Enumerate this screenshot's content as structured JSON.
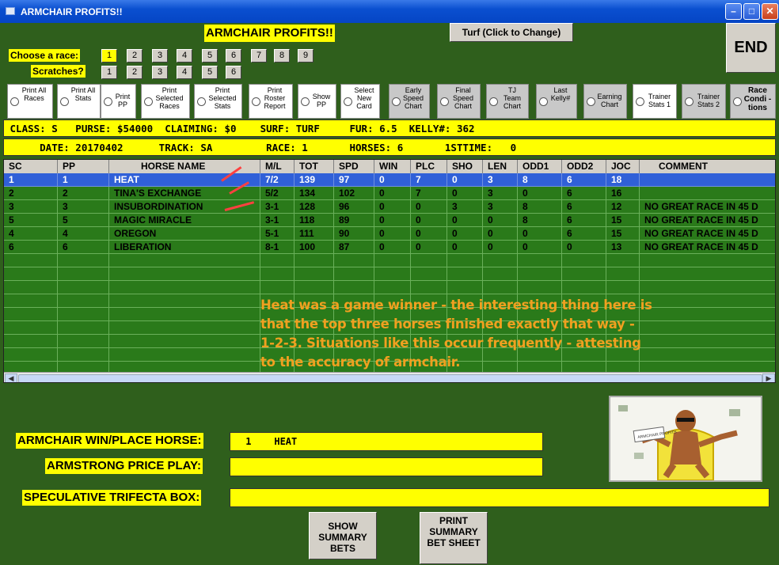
{
  "window": {
    "title": "ARMCHAIR PROFITS!!"
  },
  "header": {
    "app_title": "ARMCHAIR PROFITS!!",
    "turf_button": "Turf (Click to Change)",
    "end_button": "END",
    "choose_race_label": "Choose  a race:",
    "races": [
      "1",
      "2",
      "3",
      "4",
      "5",
      "6",
      "7",
      "8",
      "9"
    ],
    "selected_race": "1",
    "scratches_label": "Scratches?",
    "scratches": [
      "1",
      "2",
      "3",
      "4",
      "5",
      "6"
    ]
  },
  "options": [
    {
      "label": "Print All Races"
    },
    {
      "label": "Print All Stats"
    },
    {
      "label": "Print PP"
    },
    {
      "label": "Print Selected Races"
    },
    {
      "label": "Print Selected Stats"
    },
    {
      "label": "Print Roster Report"
    },
    {
      "label": "Show PP"
    },
    {
      "label": "Select New Card"
    },
    {
      "label": "Early Speed Chart"
    },
    {
      "label": "Final Speed Chart"
    },
    {
      "label": "TJ Team Chart"
    },
    {
      "label": "Last Kelly#"
    },
    {
      "label": "Earning Chart"
    },
    {
      "label": "Trainer Stats 1"
    },
    {
      "label": "Trainer Stats 2"
    },
    {
      "label": "Race Condi -tions"
    }
  ],
  "race_info": {
    "line1": " CLASS: S   PURSE: $54000  CLAIMING: $0    SURF: TURF     FUR: 6.5  KELLY#: 362",
    "line2": "      DATE: 20170402      TRACK: SA         RACE: 1       HORSES: 6       1STTIME:   0"
  },
  "table": {
    "columns": [
      "SC",
      "PP",
      "HORSE NAME",
      "M/L",
      "TOT",
      "SPD",
      "WIN",
      "PLC",
      "SHO",
      "LEN",
      "ODD1",
      "ODD2",
      "JOC",
      "COMMENT"
    ],
    "rows": [
      [
        "1",
        "1",
        "HEAT",
        "7/2",
        "139",
        "97",
        "0",
        "7",
        "0",
        "3",
        "8",
        "6",
        "18",
        ""
      ],
      [
        "2",
        "2",
        "TINA'S EXCHANGE",
        "5/2",
        "134",
        "102",
        "0",
        "7",
        "0",
        "3",
        "0",
        "6",
        "16",
        ""
      ],
      [
        "3",
        "3",
        "INSUBORDINATION",
        "3-1",
        "128",
        "96",
        "0",
        "0",
        "3",
        "3",
        "8",
        "6",
        "12",
        "NO GREAT RACE IN 45 D"
      ],
      [
        "5",
        "5",
        "MAGIC MIRACLE",
        "3-1",
        "118",
        "89",
        "0",
        "0",
        "0",
        "0",
        "8",
        "6",
        "15",
        "NO GREAT RACE IN 45 D"
      ],
      [
        "4",
        "4",
        "OREGON",
        "5-1",
        "111",
        "90",
        "0",
        "0",
        "0",
        "0",
        "0",
        "6",
        "15",
        "NO GREAT RACE IN 45 D"
      ],
      [
        "6",
        "6",
        "LIBERATION",
        "8-1",
        "100",
        "87",
        "0",
        "0",
        "0",
        "0",
        "0",
        "0",
        "13",
        "NO GREAT RACE IN 45 D"
      ]
    ]
  },
  "annotation": {
    "lines": [
      "Heat was a game winner - the interesting thing here is",
      "that the top three horses finished exactly that way -",
      "1-2-3.  Situations like  this occur frequently - attesting",
      "to the accuracy of armchair."
    ]
  },
  "summary": {
    "win_place_label": "ARMCHAIR WIN/PLACE HORSE:",
    "win_place_value": " 1    HEAT",
    "price_play_label": "ARMSTRONG PRICE PLAY:",
    "price_play_value": "",
    "trifecta_label": "SPECULATIVE TRIFECTA BOX:",
    "trifecta_value": "",
    "show_bets_button": "SHOW SUMMARY BETS",
    "print_sheet_button": "PRINT SUMMARY BET SHEET",
    "logo_caption": "ARMCHAIR PROFITS"
  }
}
